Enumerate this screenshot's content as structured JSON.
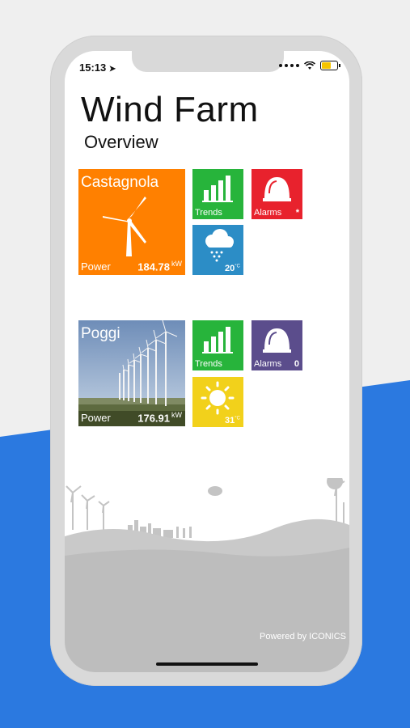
{
  "status": {
    "time": "15:13"
  },
  "header": {
    "title": "Wind Farm",
    "subtitle": "Overview"
  },
  "sites": [
    {
      "name": "Castagnola",
      "power_label": "Power",
      "power_value": "184.78",
      "power_unit": "kW",
      "trends_label": "Trends",
      "alarms_label": "Alarms",
      "alarms_value": "*",
      "weather_temp": "20",
      "weather_unit": "°C"
    },
    {
      "name": "Poggi",
      "power_label": "Power",
      "power_value": "176.91",
      "power_unit": "kW",
      "trends_label": "Trends",
      "alarms_label": "Alarms",
      "alarms_value": "0",
      "weather_temp": "31",
      "weather_unit": "°C"
    }
  ],
  "footer": {
    "powered_by": "Powered by ICONICS"
  },
  "colors": {
    "orange_tile": "#ff8000",
    "green_tile": "#27b43b",
    "red_tile": "#e8222d",
    "blue_tile": "#2c8dc6",
    "purple_tile": "#5b4d8c",
    "yellow_tile": "#f2d11b",
    "landscape_gray": "#c9c9c9",
    "bg_blue": "#2b79e0"
  }
}
